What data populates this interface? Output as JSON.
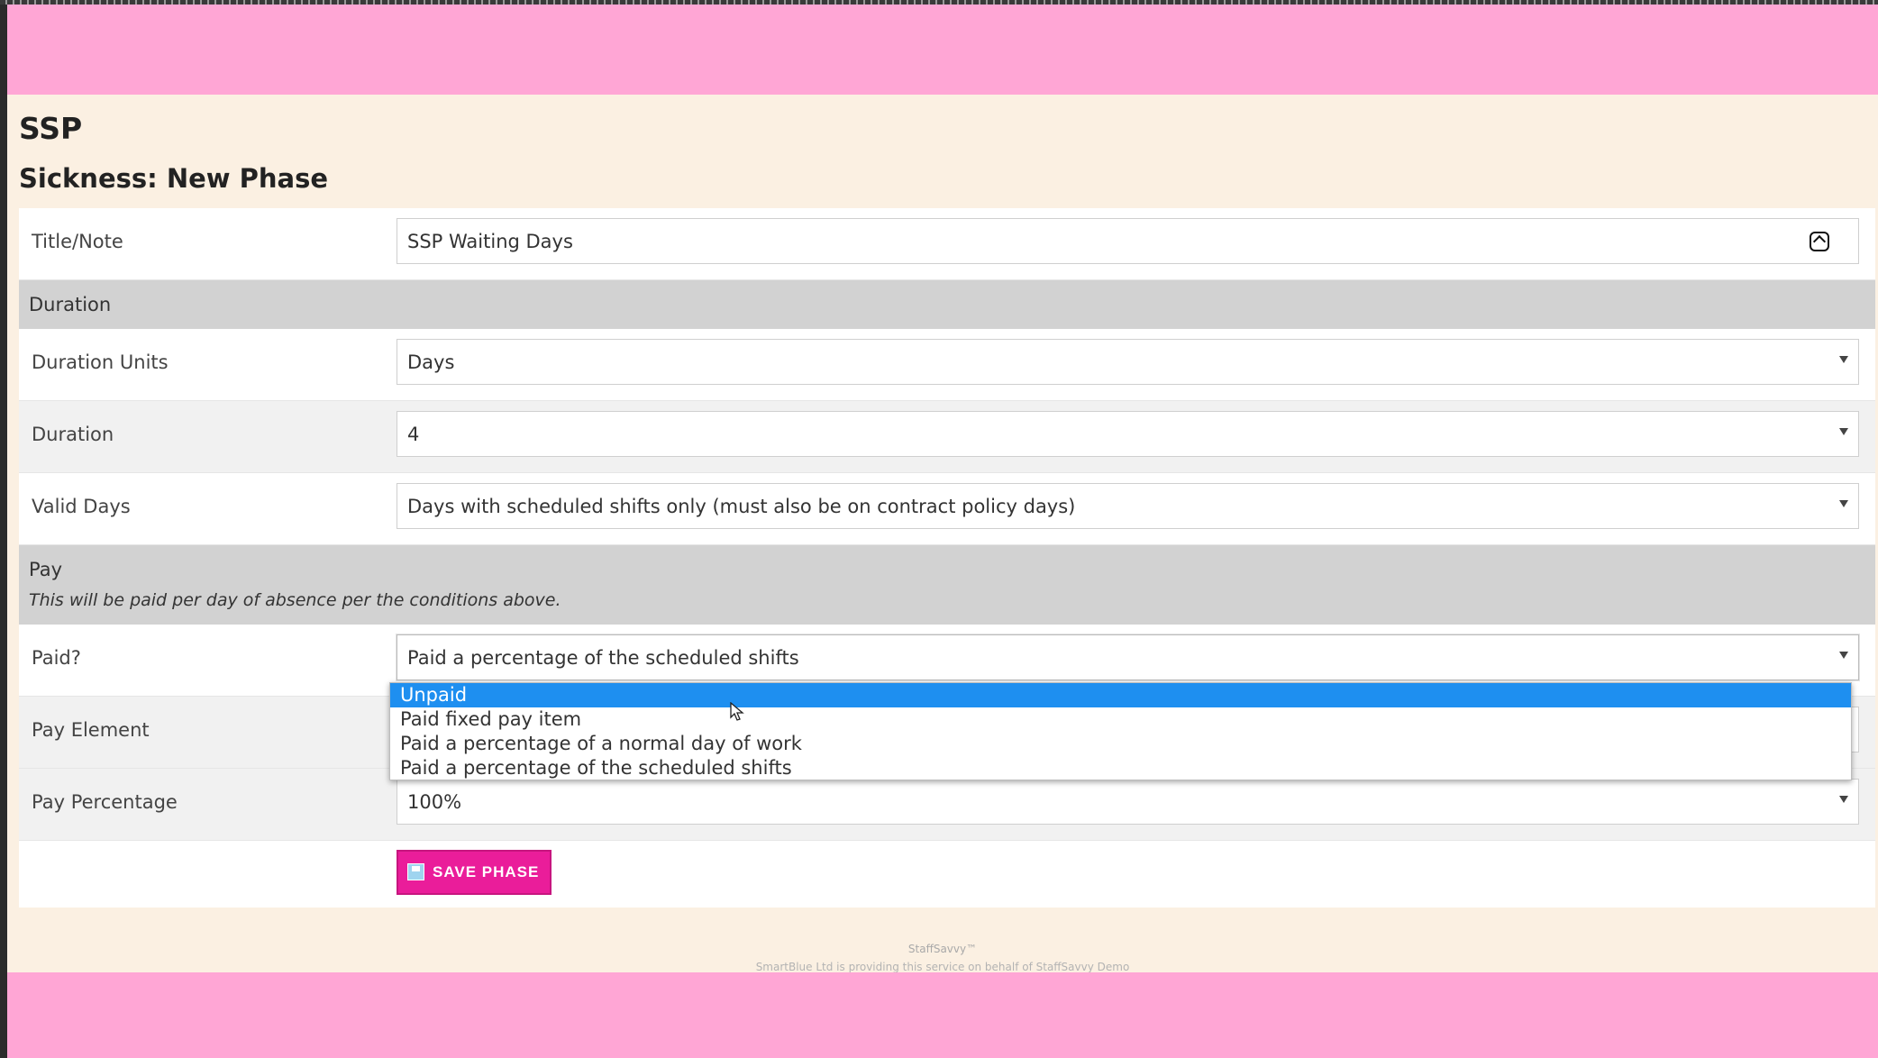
{
  "app": {
    "title": "SSP"
  },
  "page": {
    "title": "Sickness: New Phase"
  },
  "form": {
    "title_note": {
      "label": "Title/Note",
      "value": "SSP Waiting Days",
      "icon": "person-card-icon"
    },
    "duration_section": {
      "label": "Duration"
    },
    "duration_units": {
      "label": "Duration Units",
      "value": "Days"
    },
    "duration": {
      "label": "Duration",
      "value": "4"
    },
    "valid_days": {
      "label": "Valid Days",
      "value": "Days with scheduled shifts only (must also be on contract policy days)"
    },
    "pay_section": {
      "label": "Pay",
      "note": "This will be paid per day of absence per the conditions above."
    },
    "paid": {
      "label": "Paid?",
      "value": "Paid a percentage of the scheduled shifts",
      "options": [
        "Unpaid",
        "Paid fixed pay item",
        "Paid a percentage of a normal day of work",
        "Paid a percentage of the scheduled shifts"
      ],
      "highlighted_option": "Unpaid"
    },
    "pay_element": {
      "label": "Pay Element"
    },
    "pay_percentage": {
      "label": "Pay Percentage",
      "value": "100%"
    },
    "save_button": {
      "label": "SAVE PHASE",
      "icon": "save-disk-icon"
    }
  },
  "footer": {
    "brand": "StaffSavvy™",
    "credit": "SmartBlue Ltd is providing this service on behalf of StaffSavvy Demo"
  },
  "colors": {
    "header_band": "#ffa6d5",
    "content_bg": "#fbf0e2",
    "section_bg": "#d2d2d2",
    "highlight": "#1e8ff0",
    "save_button": "#ea1d9a"
  }
}
